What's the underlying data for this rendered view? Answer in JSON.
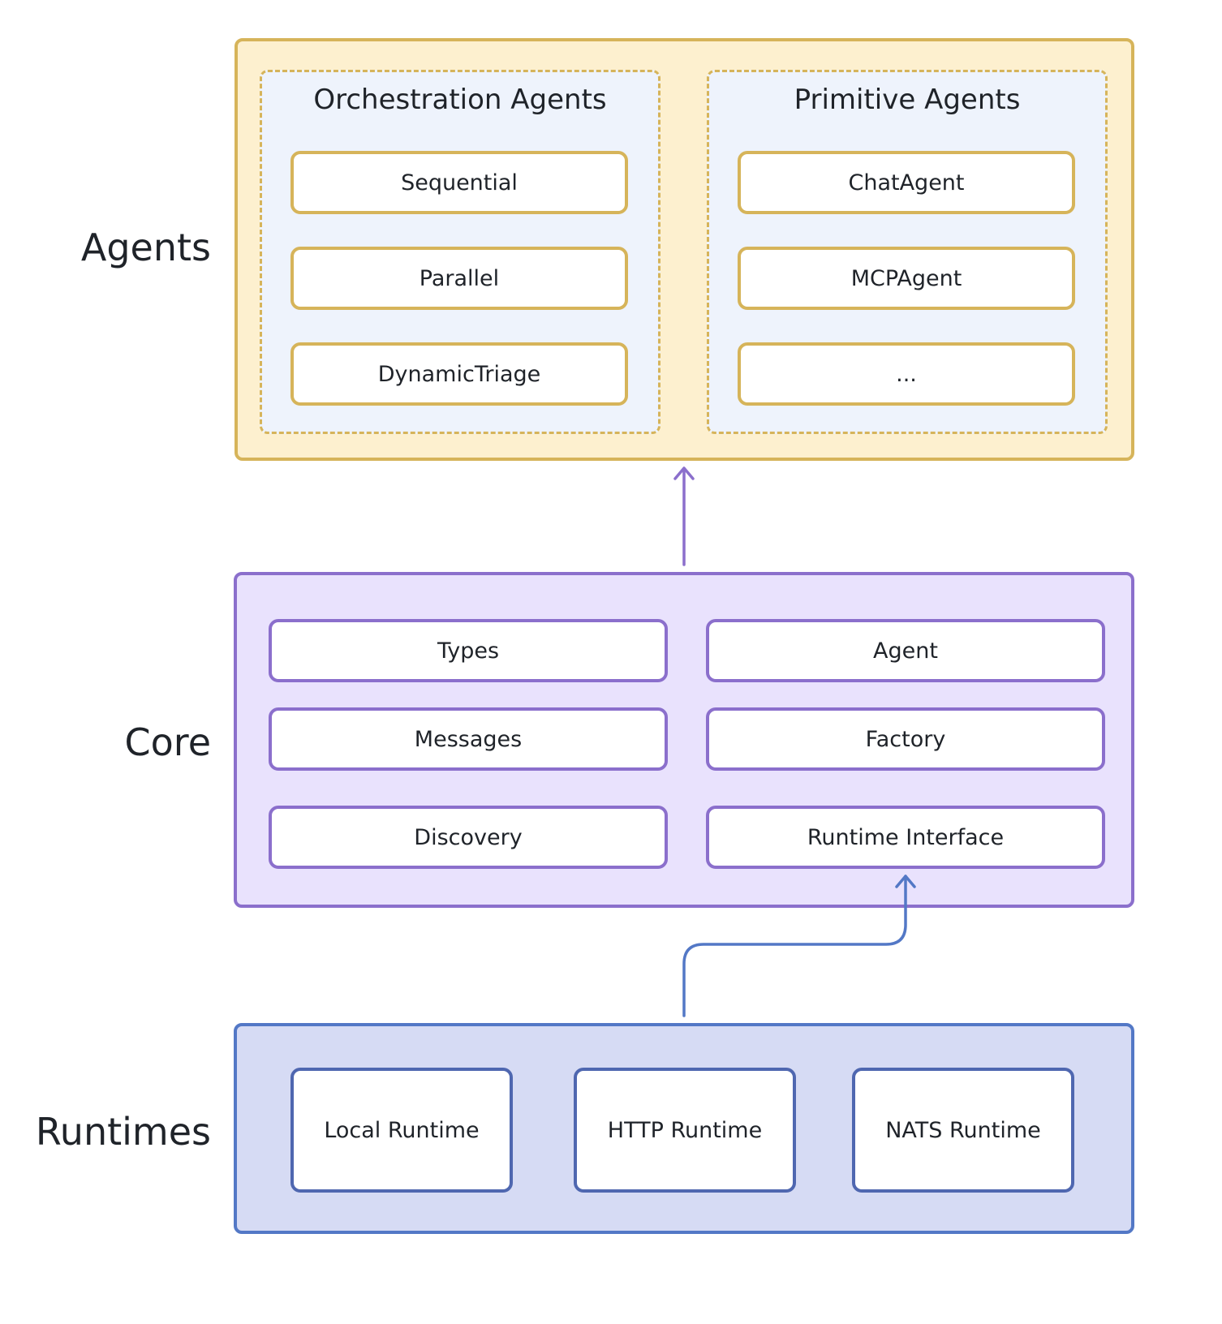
{
  "layers": {
    "agents": {
      "label": "Agents",
      "orchestration": {
        "title": "Orchestration Agents",
        "items": [
          "Sequential",
          "Parallel",
          "DynamicTriage"
        ]
      },
      "primitive": {
        "title": "Primitive Agents",
        "items": [
          "ChatAgent",
          "MCPAgent",
          "..."
        ]
      }
    },
    "core": {
      "label": "Core",
      "items": [
        "Types",
        "Agent",
        "Messages",
        "Factory",
        "Discovery",
        "Runtime Interface"
      ]
    },
    "runtimes": {
      "label": "Runtimes",
      "items": [
        "Local Runtime",
        "HTTP Runtime",
        "NATS Runtime"
      ]
    }
  },
  "edges": [
    {
      "from": "Core",
      "to": "Agents"
    },
    {
      "from": "Runtimes",
      "to": "Runtime Interface"
    }
  ],
  "colors": {
    "agents_fill": "#fdf0cf",
    "agents_border": "#d6b45a",
    "subgroup_fill": "#eef3fc",
    "core_fill": "#e9e2fd",
    "core_border": "#8b6fcc",
    "runtimes_fill": "#d6dbf4",
    "runtimes_border": "#5378c6",
    "text": "#1f2329"
  }
}
